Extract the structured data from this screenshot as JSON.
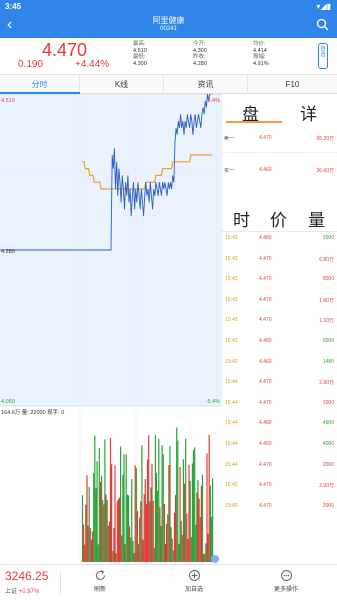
{
  "status": {
    "time": "3:45",
    "right_icons": "▾◢▮"
  },
  "nav": {
    "title": "阿里健康",
    "code": "00241"
  },
  "quote": {
    "price": "4.470",
    "change": "0.190",
    "percent": "+4.44%",
    "cols": [
      {
        "lines": [
          "最高:",
          "4.510",
          "最低:",
          "4.300"
        ]
      },
      {
        "lines": [
          "今开:",
          "4.300",
          "昨收:",
          "4.280"
        ]
      },
      {
        "lines": [
          "均价:",
          "4.414",
          "振幅:",
          "4.91%"
        ]
      }
    ],
    "add_label": "自选"
  },
  "tabs": [
    {
      "label": "分时",
      "active": true
    },
    {
      "label": "K线",
      "active": false
    },
    {
      "label": "资讯",
      "active": false
    },
    {
      "label": "F10",
      "active": false
    }
  ],
  "chart": {
    "y_high": "4.510",
    "y_high_pct": "5.4%",
    "y_prev": "4.280",
    "y_low": "4.050",
    "y_low_pct": "-5.4%",
    "vol_info": "164.6万  量: 22000  现手: 0",
    "prev_close": 4.28,
    "y_range": [
      4.05,
      4.51
    ],
    "price": [
      4.28,
      4.28,
      4.28,
      4.28,
      4.28,
      4.28,
      4.28,
      4.28,
      4.28,
      4.28,
      4.28,
      4.28,
      4.28,
      4.28,
      4.28,
      4.28,
      4.28,
      4.28,
      4.28,
      4.28,
      4.28,
      4.28,
      4.28,
      4.28,
      4.28,
      4.28,
      4.28,
      4.28,
      4.28,
      4.28,
      4.28,
      4.28,
      4.28,
      4.28,
      4.28,
      4.28,
      4.28,
      4.28,
      4.28,
      4.28,
      4.28,
      4.28,
      4.28,
      4.28,
      4.28,
      4.28,
      4.28,
      4.28,
      4.28,
      4.28,
      4.28,
      4.28,
      4.28,
      4.28,
      4.28,
      4.28,
      4.28,
      4.28,
      4.28,
      4.28,
      4.28,
      4.28,
      4.28,
      4.28,
      4.28,
      4.28,
      4.28,
      4.28,
      4.28,
      4.28,
      4.28,
      4.28,
      4.28,
      4.28,
      4.28,
      4.28,
      4.28,
      4.28,
      4.28,
      4.28,
      4.28,
      4.28,
      4.28,
      4.28,
      4.28,
      4.28,
      4.28,
      4.28,
      4.28,
      4.28,
      4.28,
      4.28,
      4.28,
      4.28,
      4.28,
      4.28,
      4.28,
      4.28,
      4.28,
      4.28,
      4.42,
      4.4,
      4.43,
      4.37,
      4.41,
      4.36,
      4.4,
      4.38,
      4.35,
      4.39,
      4.37,
      4.34,
      4.38,
      4.36,
      4.39,
      4.35,
      4.37,
      4.33,
      4.36,
      4.38,
      4.34,
      4.37,
      4.35,
      4.38,
      4.36,
      4.34,
      4.37,
      4.35,
      4.33,
      4.36,
      4.38,
      4.36,
      4.37,
      4.35,
      4.38,
      4.36,
      4.34,
      4.37,
      4.36,
      4.38,
      4.37,
      4.36,
      4.38,
      4.37,
      4.36,
      4.38,
      4.37,
      4.38,
      4.37,
      4.36,
      4.38,
      4.37,
      4.38,
      4.37,
      4.39,
      4.38,
      4.44,
      4.46,
      4.45,
      4.47,
      4.46,
      4.48,
      4.46,
      4.47,
      4.45,
      4.47,
      4.46,
      4.48,
      4.47,
      4.46,
      4.48,
      4.47,
      4.45,
      4.47,
      4.48,
      4.46,
      4.47,
      4.48,
      4.47,
      4.46,
      4.48,
      4.49,
      4.48,
      4.5,
      4.49,
      4.51,
      4.5,
      4.51,
      4.51,
      4.51
    ],
    "avg": [
      4.41,
      4.41,
      4.41,
      4.4,
      4.4,
      4.4,
      4.4,
      4.39,
      4.39,
      4.39,
      4.39,
      4.38,
      4.38,
      4.38,
      4.38,
      4.38,
      4.38,
      4.37,
      4.37,
      4.37,
      4.37,
      4.37,
      4.37,
      4.37,
      4.37,
      4.37,
      4.37,
      4.37,
      4.37,
      4.37,
      4.37,
      4.37,
      4.37,
      4.37,
      4.37,
      4.37,
      4.37,
      4.37,
      4.37,
      4.37,
      4.37,
      4.37,
      4.37,
      4.37,
      4.37,
      4.37,
      4.37,
      4.37,
      4.37,
      4.37,
      4.37,
      4.37,
      4.37,
      4.37,
      4.37,
      4.37,
      4.37,
      4.38,
      4.38,
      4.38,
      4.38,
      4.38,
      4.38,
      4.38,
      4.38,
      4.38,
      4.39,
      4.39,
      4.39,
      4.39,
      4.39,
      4.39,
      4.4,
      4.4,
      4.4,
      4.4,
      4.4,
      4.4,
      4.4,
      4.4,
      4.4,
      4.41,
      4.41,
      4.41,
      4.41,
      4.41,
      4.41,
      4.41,
      4.41,
      4.41,
      4.41,
      4.41,
      4.41,
      4.41,
      4.41,
      4.41,
      4.41,
      4.42,
      4.42,
      4.42,
      4.42,
      4.42,
      4.42,
      4.42,
      4.42,
      4.42,
      4.42,
      4.42,
      4.42,
      4.42,
      4.42,
      4.42,
      4.42,
      4.42,
      4.42,
      4.42,
      4.42
    ]
  },
  "orderbook": {
    "title_a": "盘",
    "title_b": "详",
    "sell": {
      "label": "卖一",
      "price": "4.470",
      "vol": "95.20万"
    },
    "buy": {
      "label": "买一",
      "price": "4.460",
      "vol": "36.60万"
    }
  },
  "trades": {
    "title": [
      "时",
      "价",
      "量"
    ],
    "rows": [
      {
        "time": "15:43",
        "price": "4.460",
        "vol": "2000",
        "dir": "down"
      },
      {
        "time": "15:43",
        "price": "4.470",
        "vol": "6.80万",
        "dir": "up"
      },
      {
        "time": "15:43",
        "price": "4.470",
        "vol": "8000",
        "dir": "up"
      },
      {
        "time": "15:43",
        "price": "4.470",
        "vol": "1.60万",
        "dir": "up"
      },
      {
        "time": "15:43",
        "price": "4.470",
        "vol": "1.00万",
        "dir": "up"
      },
      {
        "time": "15:43",
        "price": "4.460",
        "vol": "6000",
        "dir": "down"
      },
      {
        "time": "15:43",
        "price": "4.460",
        "vol": "1480",
        "dir": "down"
      },
      {
        "time": "15:44",
        "price": "4.470",
        "vol": "2.80万",
        "dir": "up"
      },
      {
        "time": "15:44",
        "price": "4.470",
        "vol": "2000",
        "dir": "up"
      },
      {
        "time": "15:44",
        "price": "4.460",
        "vol": "4900",
        "dir": "down"
      },
      {
        "time": "15:44",
        "price": "4.460",
        "vol": "4000",
        "dir": "down"
      },
      {
        "time": "15:44",
        "price": "4.470",
        "vol": "2000",
        "dir": "up"
      },
      {
        "time": "15:45",
        "price": "4.470",
        "vol": "2.00万",
        "dir": "up"
      },
      {
        "time": "15:45",
        "price": "4.470",
        "vol": "2000",
        "dir": "up"
      }
    ]
  },
  "bottom": {
    "index_value": "3246.25",
    "index_name": "上证",
    "index_change": "+0.97%",
    "refresh": "刷新",
    "add_watch": "加自选",
    "more": "更多操作"
  },
  "colors": {
    "up": "#e63a3a",
    "down": "#2aa43a",
    "accent": "#2f86e8",
    "avg": "#f0a030",
    "price": "#2b5fc5"
  }
}
